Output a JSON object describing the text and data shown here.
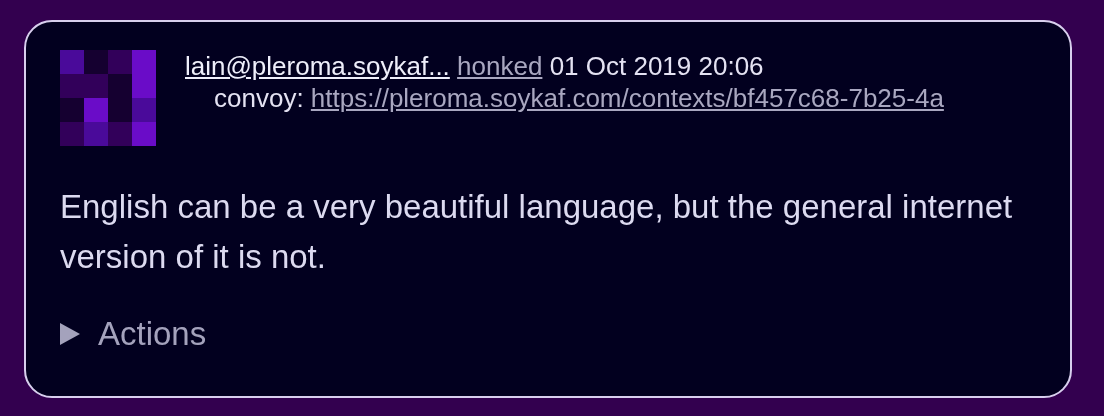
{
  "post": {
    "author": "lain@pleroma.soykaf...",
    "verb": "honked",
    "date": "01 Oct 2019 20:06",
    "convoy_label": "convoy:",
    "convoy_link": "https://pleroma.soykaf.com/contexts/bf457c68-7b25-4a",
    "content": "English can be a very beautiful language, but the general internet version of it is not.",
    "actions": {
      "label": "Actions",
      "expanded": false
    }
  }
}
